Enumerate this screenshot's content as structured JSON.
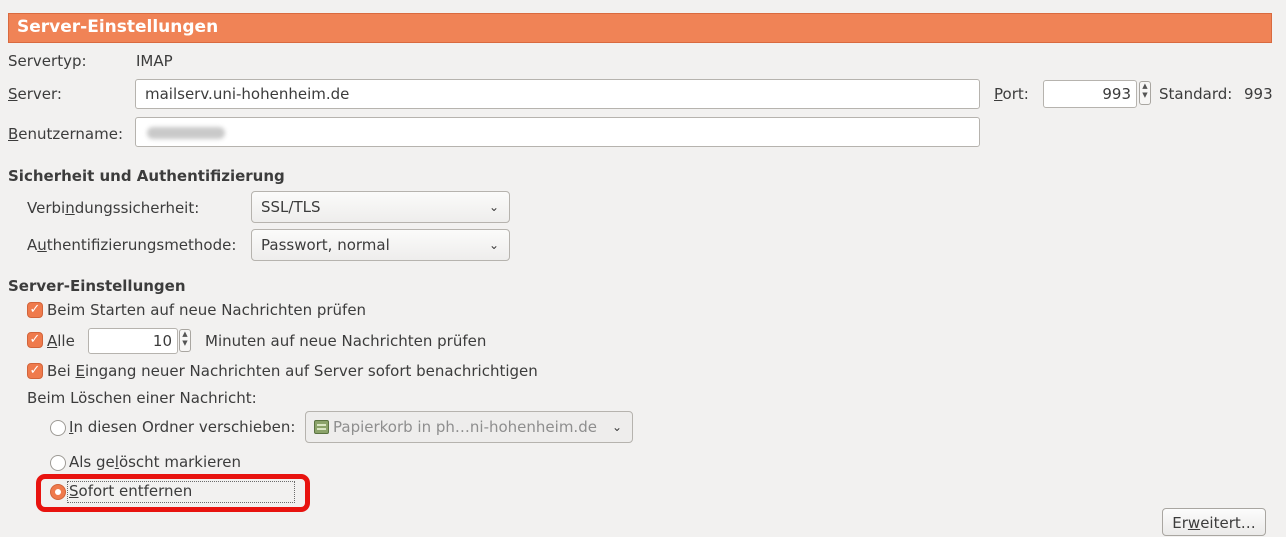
{
  "header": {
    "title": "Server-Einstellungen"
  },
  "server_info": {
    "type_label": "Servertyp:",
    "type_value": "IMAP",
    "server_label": "Server:",
    "server_value": "mailserv.uni-hohenheim.de",
    "port_label": "Port:",
    "port_value": "993",
    "default_label": "Standard:",
    "default_value": "993",
    "username_label": "Benutzername:"
  },
  "security": {
    "section_title": "Sicherheit und Authentifizierung",
    "connection_label": "Verbindungssicherheit:",
    "connection_value": "SSL/TLS",
    "auth_label": "Authentifizierungsmethode:",
    "auth_value": "Passwort, normal"
  },
  "server_settings": {
    "section_title": "Server-Einstellungen",
    "check_on_start_label": "Beim Starten auf neue Nachrichten prüfen",
    "check_on_start_checked": true,
    "check_every_label": "Alle",
    "check_every_minutes": "10",
    "check_every_suffix": "Minuten auf neue Nachrichten prüfen",
    "check_every_checked": true,
    "notify_label": "Bei Eingang neuer Nachrichten auf Server sofort benachrichtigen",
    "notify_checked": true,
    "delete_heading": "Beim Löschen einer Nachricht:",
    "delete_options": [
      {
        "label": "In diesen Ordner verschieben:",
        "selected": false
      },
      {
        "label": "Als gelöscht markieren",
        "selected": false
      },
      {
        "label": "Sofort entfernen",
        "selected": true
      }
    ],
    "trash_folder_value": "Papierkorb in ph…ni-hohenheim.de"
  },
  "buttons": {
    "advanced_label": "Erweitert…"
  },
  "colors": {
    "accent": "#f08356",
    "checkbox": "#ef7a4c",
    "highlight": "#e8130f",
    "background": "#f2f1f0"
  }
}
